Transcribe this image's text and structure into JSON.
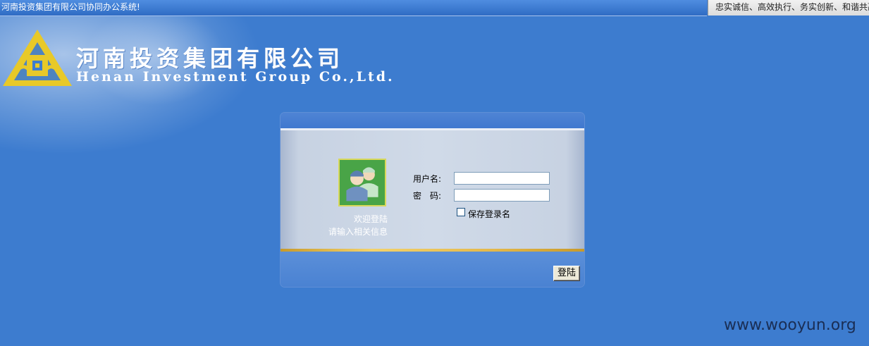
{
  "titlebar": {
    "text": "河南投资集团有限公司协同办公系统!"
  },
  "marquee": {
    "text": "忠实诚信、高效执行、务实创新、和谐共赢"
  },
  "brand": {
    "name_cn": "河南投资集团有限公司",
    "name_en": "Henan Investment Group Co.,Ltd.",
    "logo_color": "#e8c928"
  },
  "login": {
    "welcome_line1": "欢迎登陆",
    "welcome_line2": "请输入相关信息",
    "username_label": "用户名:",
    "password_label": "密　码:",
    "username_value": "",
    "password_value": "",
    "remember_label": "保存登录名",
    "remember_checked": false,
    "submit_label": "登陆"
  },
  "watermark": "www.wooyun.org"
}
